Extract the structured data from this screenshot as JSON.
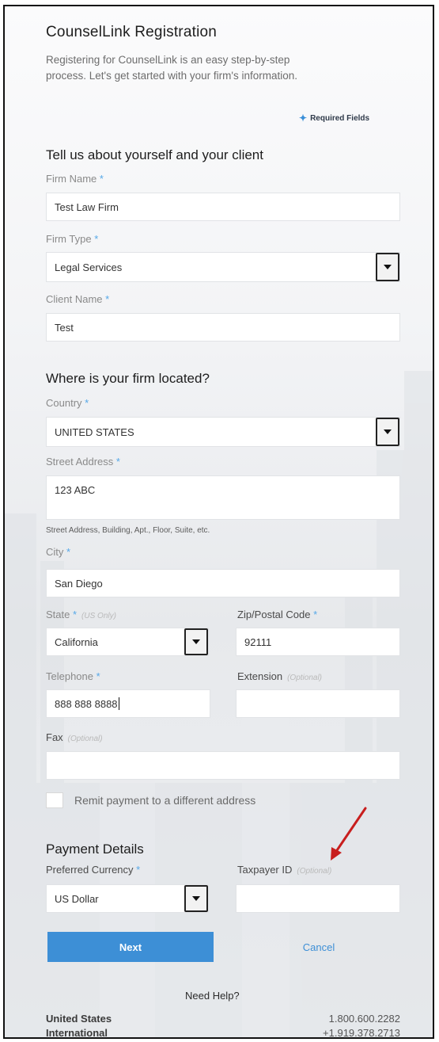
{
  "header": {
    "title": "CounselLink Registration",
    "intro_line1": "Registering for CounselLink is an easy step-by-step",
    "intro_line2": "process. Let's get started with your firm's information.",
    "required_note": "Required Fields"
  },
  "about": {
    "heading": "Tell us about yourself and your client",
    "firm_name_label": "Firm Name",
    "firm_name_value": "Test Law Firm",
    "firm_type_label": "Firm Type",
    "firm_type_value": "Legal Services",
    "client_name_label": "Client Name",
    "client_name_value": "Test"
  },
  "location": {
    "heading": "Where is your firm located?",
    "country_label": "Country",
    "country_value": "UNITED STATES",
    "street_label": "Street Address",
    "street_value": "123 ABC",
    "street_hint": "Street Address, Building, Apt., Floor, Suite, etc.",
    "city_label": "City",
    "city_value": "San Diego",
    "state_label": "State",
    "state_note": "(US Only)",
    "state_value": "California",
    "zip_label": "Zip/Postal Code",
    "zip_value": "92111",
    "phone_label": "Telephone",
    "phone_value": "888 888 8888",
    "ext_label": "Extension",
    "ext_note": "(Optional)",
    "ext_value": "",
    "fax_label": "Fax",
    "fax_note": "(Optional)",
    "fax_value": "",
    "remit_label": "Remit payment to a different address"
  },
  "payment": {
    "heading": "Payment Details",
    "currency_label": "Preferred Currency",
    "currency_value": "US Dollar",
    "taxpayer_label": "Taxpayer ID",
    "taxpayer_note": "(Optional)",
    "taxpayer_value": ""
  },
  "actions": {
    "next_label": "Next",
    "cancel_label": "Cancel"
  },
  "help": {
    "title": "Need Help?",
    "contacts": [
      {
        "region": "United States",
        "phone": "1.800.600.2282"
      },
      {
        "region": "International",
        "phone": "+1.919.378.2713"
      }
    ]
  },
  "colors": {
    "accent": "#3d8fd6",
    "required_star": "#56a8e8",
    "annotation_arrow": "#c81e1e"
  }
}
